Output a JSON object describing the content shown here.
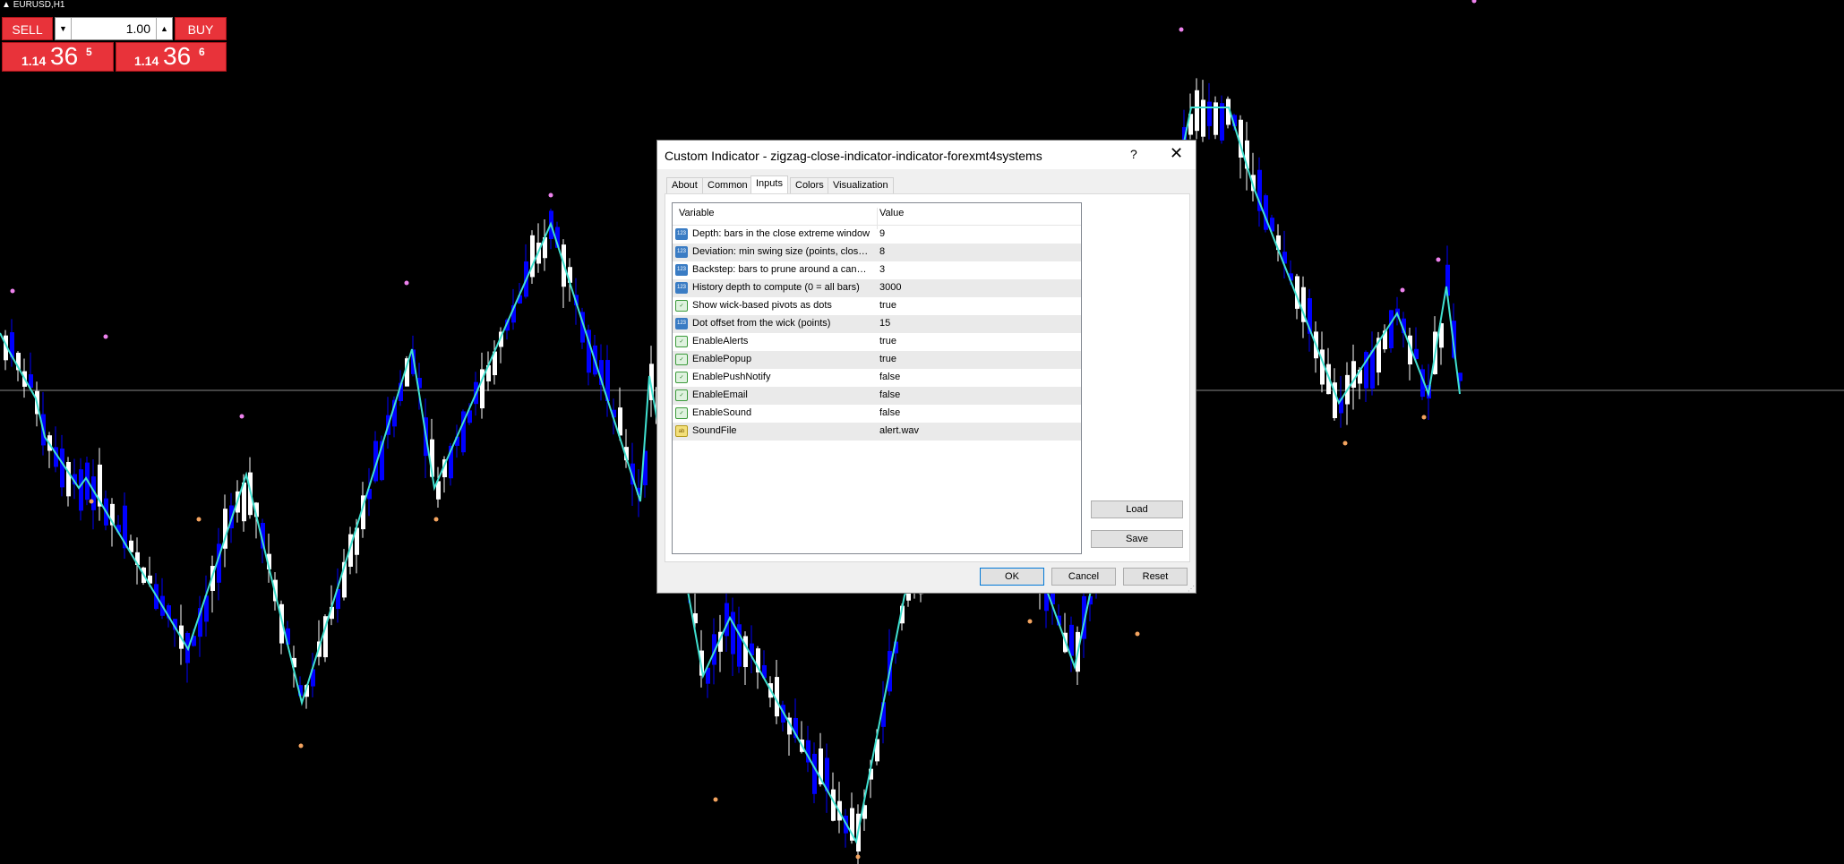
{
  "chart": {
    "symbol": "EURUSD,H1",
    "background": "#000000",
    "bull_color": "#ffffff",
    "bear_color": "#0000ff",
    "zigzag_color": "#40e0d0",
    "high_dot_color": "#ee82ee",
    "low_dot_color": "#f4a460"
  },
  "trade_panel": {
    "sell_label": "SELL",
    "buy_label": "BUY",
    "lot_value": "1.00",
    "lot_down_icon": "triangle-down-icon",
    "lot_up_icon": "triangle-up-icon",
    "sell_price": {
      "small": "1.14",
      "big": "36",
      "sup": "5"
    },
    "buy_price": {
      "small": "1.14",
      "big": "36",
      "sup": "6"
    }
  },
  "dialog": {
    "title": "Custom Indicator - zigzag-close-indicator-indicator-forexmt4systems",
    "help": "?",
    "close": "✕",
    "tabs": [
      {
        "label": "About"
      },
      {
        "label": "Common"
      },
      {
        "label": "Inputs"
      },
      {
        "label": "Colors"
      },
      {
        "label": "Visualization"
      }
    ],
    "active_tab": "Inputs",
    "columns": {
      "variable": "Variable",
      "value": "Value"
    },
    "rows": [
      {
        "type": "int",
        "icon": "123",
        "name": "Depth: bars in the close extreme window",
        "value": "9"
      },
      {
        "type": "int",
        "icon": "123",
        "name": "Deviation: min swing size (points, close b...",
        "value": "8"
      },
      {
        "type": "int",
        "icon": "123",
        "name": "Backstep: bars to prune around a candi...",
        "value": "3"
      },
      {
        "type": "int",
        "icon": "123",
        "name": "History depth to compute (0 = all bars)",
        "value": "3000"
      },
      {
        "type": "bool",
        "icon": "✓",
        "name": "Show wick-based pivots as dots",
        "value": "true"
      },
      {
        "type": "int",
        "icon": "123",
        "name": "Dot offset from the wick (points)",
        "value": "15"
      },
      {
        "type": "bool",
        "icon": "✓",
        "name": "EnableAlerts",
        "value": "true"
      },
      {
        "type": "bool",
        "icon": "✓",
        "name": "EnablePopup",
        "value": "true"
      },
      {
        "type": "bool",
        "icon": "✓",
        "name": "EnablePushNotify",
        "value": "false"
      },
      {
        "type": "bool",
        "icon": "✓",
        "name": "EnableEmail",
        "value": "false"
      },
      {
        "type": "bool",
        "icon": "✓",
        "name": "EnableSound",
        "value": "false"
      },
      {
        "type": "str",
        "icon": "ab",
        "name": "SoundFile",
        "value": "alert.wav"
      }
    ],
    "buttons": {
      "load": "Load",
      "save": "Save",
      "ok": "OK",
      "cancel": "Cancel",
      "reset": "Reset"
    }
  }
}
